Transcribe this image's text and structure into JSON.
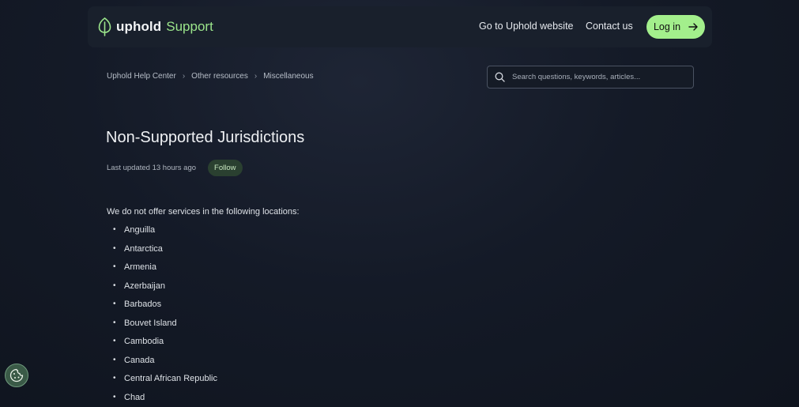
{
  "header": {
    "brand": "uphold",
    "brand_suffix": "Support",
    "nav_website": "Go to Uphold website",
    "nav_contact": "Contact us",
    "login_label": "Log in"
  },
  "breadcrumb": {
    "items": [
      "Uphold Help Center",
      "Other resources",
      "Miscellaneous"
    ]
  },
  "search": {
    "placeholder": "Search questions, keywords, articles..."
  },
  "article": {
    "title": "Non-Supported Jurisdictions",
    "updated": "Last updated 13 hours ago",
    "follow_label": "Follow",
    "intro": "We do not offer services in the following locations:",
    "countries": [
      "Anguilla",
      "Antarctica",
      "Armenia",
      "Azerbaijan",
      "Barbados",
      "Bouvet Island",
      "Cambodia",
      "Canada",
      "Central African Republic",
      "Chad"
    ]
  },
  "colors": {
    "accent": "#a3ef8c",
    "brand_support": "#9be58b",
    "background": "#141a27"
  },
  "icons": {
    "logo": "uphold-leaf-icon",
    "login_arrow": "arrow-right-icon",
    "search": "search-icon",
    "cookie": "cookie-icon"
  }
}
